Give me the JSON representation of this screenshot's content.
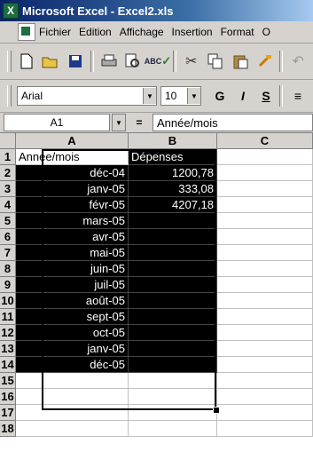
{
  "window": {
    "title": "Microsoft Excel - Excel2.xls",
    "app_icon": "excel-icon"
  },
  "menu": [
    "Fichier",
    "Edition",
    "Affichage",
    "Insertion",
    "Format",
    "O"
  ],
  "toolbar": {
    "icons": [
      "new-icon",
      "open-icon",
      "save-icon",
      "print-icon",
      "print-preview-icon",
      "spelling-icon",
      "cut-icon",
      "copy-icon",
      "paste-icon",
      "format-painter-icon",
      "undo-icon"
    ]
  },
  "format_toolbar": {
    "font": "Arial",
    "size": "10",
    "bold_label": "G",
    "italic_label": "I",
    "underline_label": "S"
  },
  "formula_bar": {
    "name_box": "A1",
    "equals": "=",
    "content": "Année/mois"
  },
  "sheet": {
    "columns": [
      "A",
      "B",
      "C"
    ],
    "rows": [
      {
        "n": "1",
        "a": "Année/mois",
        "b": "Dépenses"
      },
      {
        "n": "2",
        "a": "déc-04",
        "b": "1200,78"
      },
      {
        "n": "3",
        "a": "janv-05",
        "b": "333,08"
      },
      {
        "n": "4",
        "a": "févr-05",
        "b": "4207,18"
      },
      {
        "n": "5",
        "a": "mars-05",
        "b": ""
      },
      {
        "n": "6",
        "a": "avr-05",
        "b": ""
      },
      {
        "n": "7",
        "a": "mai-05",
        "b": ""
      },
      {
        "n": "8",
        "a": "juin-05",
        "b": ""
      },
      {
        "n": "9",
        "a": "juil-05",
        "b": ""
      },
      {
        "n": "10",
        "a": "août-05",
        "b": ""
      },
      {
        "n": "11",
        "a": "sept-05",
        "b": ""
      },
      {
        "n": "12",
        "a": "oct-05",
        "b": ""
      },
      {
        "n": "13",
        "a": "janv-05",
        "b": ""
      },
      {
        "n": "14",
        "a": "déc-05",
        "b": ""
      },
      {
        "n": "15",
        "a": "",
        "b": ""
      },
      {
        "n": "16",
        "a": "",
        "b": ""
      },
      {
        "n": "17",
        "a": "",
        "b": ""
      },
      {
        "n": "18",
        "a": "",
        "b": ""
      }
    ]
  },
  "colors": {
    "selection": "#000000",
    "title_bar": "#0a246a",
    "chrome": "#d6d3ce"
  }
}
